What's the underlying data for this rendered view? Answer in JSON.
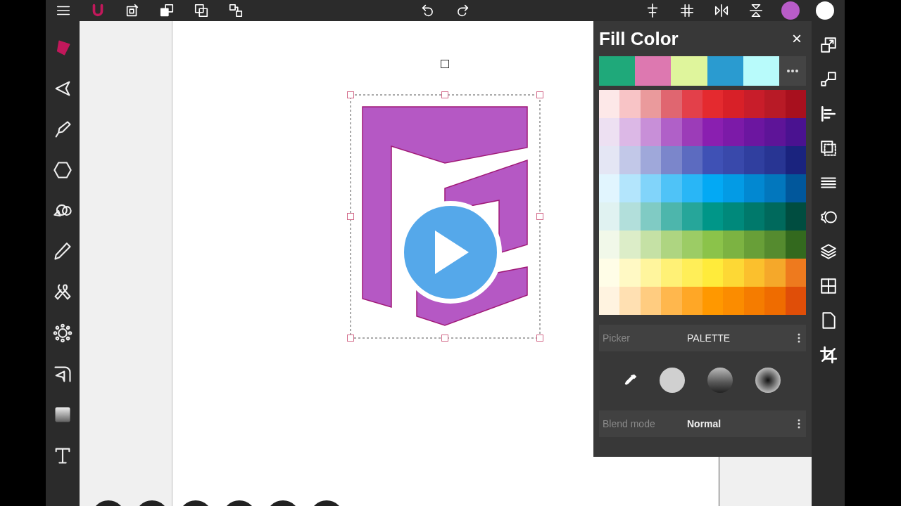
{
  "top_bar": {
    "color_swatches": [
      {
        "color": "#b85cc8"
      },
      {
        "color": "#ffffff"
      }
    ]
  },
  "tools": [
    {
      "selected": true
    },
    {
      "selected": false
    },
    {
      "selected": false
    },
    {
      "selected": false
    },
    {
      "selected": false
    },
    {
      "selected": false
    },
    {
      "selected": false
    },
    {
      "selected": false
    },
    {
      "selected": false
    },
    {
      "selected": false
    },
    {
      "selected": false
    }
  ],
  "fill_panel": {
    "title": "Fill Color",
    "close": "×",
    "recent_colors": [
      {
        "color": "#1fa97a"
      },
      {
        "color": "#dd78b0"
      },
      {
        "color": "#dff59c"
      },
      {
        "color": "#2a9bd0"
      },
      {
        "color": "#b8fbfb"
      }
    ],
    "palette": [
      {
        "swatches": [
          {
            "color": "#fde8e8"
          },
          {
            "color": "#f8c4c6"
          },
          {
            "color": "#ea9a9c"
          },
          {
            "color": "#e06670"
          },
          {
            "color": "#e3404a"
          },
          {
            "color": "#e42a2f"
          },
          {
            "color": "#d82028"
          },
          {
            "color": "#c81d2a"
          },
          {
            "color": "#b81a26"
          },
          {
            "color": "#a8101e"
          }
        ]
      },
      {
        "swatches": [
          {
            "color": "#ede0f2"
          },
          {
            "color": "#dcb8e6"
          },
          {
            "color": "#c88fd8"
          },
          {
            "color": "#b060c8"
          },
          {
            "color": "#9c3cb8"
          },
          {
            "color": "#8a1fb0"
          },
          {
            "color": "#7c1aa8"
          },
          {
            "color": "#6c16a0"
          },
          {
            "color": "#5e1498"
          },
          {
            "color": "#4a1290"
          }
        ]
      },
      {
        "swatches": [
          {
            "color": "#e4e6f4"
          },
          {
            "color": "#c2c8e8"
          },
          {
            "color": "#9fa8da"
          },
          {
            "color": "#7b86cb"
          },
          {
            "color": "#5c6bc0"
          },
          {
            "color": "#3f51b5"
          },
          {
            "color": "#3949ab"
          },
          {
            "color": "#303f9f"
          },
          {
            "color": "#283593"
          },
          {
            "color": "#1a237e"
          }
        ]
      },
      {
        "swatches": [
          {
            "color": "#e1f5fe"
          },
          {
            "color": "#b3e5fc"
          },
          {
            "color": "#81d4fa"
          },
          {
            "color": "#4fc3f7"
          },
          {
            "color": "#29b6f6"
          },
          {
            "color": "#03a9f4"
          },
          {
            "color": "#039be5"
          },
          {
            "color": "#0288d1"
          },
          {
            "color": "#0277bd"
          },
          {
            "color": "#01579b"
          }
        ]
      },
      {
        "swatches": [
          {
            "color": "#e0f2f1"
          },
          {
            "color": "#b2dfdb"
          },
          {
            "color": "#80cbc4"
          },
          {
            "color": "#4db6ac"
          },
          {
            "color": "#26a69a"
          },
          {
            "color": "#009688"
          },
          {
            "color": "#00897b"
          },
          {
            "color": "#00796b"
          },
          {
            "color": "#00695c"
          },
          {
            "color": "#004d40"
          }
        ]
      },
      {
        "swatches": [
          {
            "color": "#f1f8e9"
          },
          {
            "color": "#dcedc8"
          },
          {
            "color": "#c5e1a5"
          },
          {
            "color": "#aed581"
          },
          {
            "color": "#9ccc65"
          },
          {
            "color": "#8bc34a"
          },
          {
            "color": "#7cb342"
          },
          {
            "color": "#689f38"
          },
          {
            "color": "#558b2f"
          },
          {
            "color": "#33691e"
          }
        ]
      },
      {
        "swatches": [
          {
            "color": "#fffde7"
          },
          {
            "color": "#fff9c4"
          },
          {
            "color": "#fff59d"
          },
          {
            "color": "#fff176"
          },
          {
            "color": "#ffee58"
          },
          {
            "color": "#ffeb3b"
          },
          {
            "color": "#fdd835"
          },
          {
            "color": "#fbc02d"
          },
          {
            "color": "#f5a82a"
          },
          {
            "color": "#ee7a1e"
          }
        ]
      },
      {
        "swatches": [
          {
            "color": "#fff3e0"
          },
          {
            "color": "#ffe0b2"
          },
          {
            "color": "#ffcc80"
          },
          {
            "color": "#ffb74d"
          },
          {
            "color": "#ffa726"
          },
          {
            "color": "#ff9800"
          },
          {
            "color": "#fb8c00"
          },
          {
            "color": "#f57c00"
          },
          {
            "color": "#ef6c00"
          },
          {
            "color": "#e04e08"
          }
        ]
      }
    ],
    "picker": {
      "label": "Picker",
      "value": "PALETTE"
    },
    "fill_types": [
      {
        "kind": "eyedropper"
      },
      {
        "kind": "solid"
      },
      {
        "kind": "linear"
      },
      {
        "kind": "radial"
      }
    ],
    "blend_mode": {
      "label": "Blend mode",
      "value": "Normal"
    }
  }
}
